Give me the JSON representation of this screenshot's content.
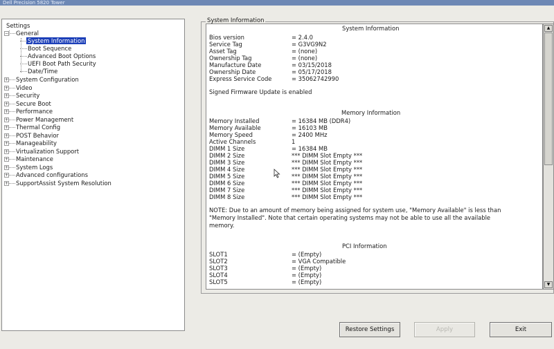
{
  "window": {
    "title": "Dell Precision 5820 Tower"
  },
  "tree": {
    "root": "Settings",
    "general": {
      "label": "General",
      "children": [
        "System Information",
        "Boot Sequence",
        "Advanced Boot Options",
        "UEFI Boot Path Security",
        "Date/Time"
      ]
    },
    "sections": [
      "System Configuration",
      "Video",
      "Security",
      "Secure Boot",
      "Performance",
      "Power Management",
      "Thermal Config",
      "POST Behavior",
      "Manageability",
      "Virtualization Support",
      "Maintenance",
      "System Logs",
      "Advanced configurations",
      "SupportAssist System Resolution"
    ]
  },
  "panel": {
    "group_label": "System Information",
    "system": {
      "title": "System Information",
      "rows": [
        {
          "key": "Bios version",
          "value": "= 2.4.0"
        },
        {
          "key": "Service Tag",
          "value": "= G3VG9N2"
        },
        {
          "key": "Asset Tag",
          "value": "= (none)"
        },
        {
          "key": "Ownership Tag",
          "value": "= (none)"
        },
        {
          "key": "Manufacture Date",
          "value": "= 03/15/2018"
        },
        {
          "key": "Ownership Date",
          "value": "= 05/17/2018"
        },
        {
          "key": "Express Service Code",
          "value": "= 35062742990"
        }
      ],
      "firmware_note": "Signed Firmware Update is enabled"
    },
    "memory": {
      "title": "Memory Information",
      "rows": [
        {
          "key": "Memory Installed",
          "value": "= 16384 MB (DDR4)"
        },
        {
          "key": "Memory Available",
          "value": "= 16103 MB"
        },
        {
          "key": "Memory Speed",
          "value": "= 2400 MHz"
        },
        {
          "key": "Active Channels",
          "value": "1"
        },
        {
          "key": "DIMM 1 Size",
          "value": "= 16384 MB"
        },
        {
          "key": "DIMM 2 Size",
          "value": "*** DIMM Slot Empty ***"
        },
        {
          "key": "DIMM 3 Size",
          "value": "*** DIMM Slot Empty ***"
        },
        {
          "key": "DIMM 4 Size",
          "value": "*** DIMM Slot Empty ***"
        },
        {
          "key": "DIMM 5 Size",
          "value": "*** DIMM Slot Empty ***"
        },
        {
          "key": "DIMM 6 Size",
          "value": "*** DIMM Slot Empty ***"
        },
        {
          "key": "DIMM 7 Size",
          "value": "*** DIMM Slot Empty ***"
        },
        {
          "key": "DIMM 8 Size",
          "value": "*** DIMM Slot Empty ***"
        }
      ],
      "note": "NOTE: Due to an amount of memory being assigned for system use, \"Memory Available\" is less than \"Memory Installed\". Note that certain operating systems may not be able to use all the available memory."
    },
    "pci": {
      "title": "PCI Information",
      "rows": [
        {
          "key": "SLOT1",
          "value": "= (Empty)"
        },
        {
          "key": "SLOT2",
          "value": "= VGA Compatible"
        },
        {
          "key": "SLOT3",
          "value": "= (Empty)"
        },
        {
          "key": "SLOT4",
          "value": "= (Empty)"
        },
        {
          "key": "SLOT5",
          "value": "= (Empty)"
        }
      ]
    }
  },
  "buttons": {
    "restore": "Restore Settings",
    "apply": "Apply",
    "exit": "Exit"
  },
  "icons": {
    "expand": "plus-box-icon",
    "collapse": "minus-box-icon",
    "scroll_up": "arrow-up-icon",
    "scroll_down": "arrow-down-icon",
    "cursor": "mouse-pointer-icon"
  },
  "colors": {
    "selection": "#1c3fb8",
    "background": "#ecebe6"
  }
}
